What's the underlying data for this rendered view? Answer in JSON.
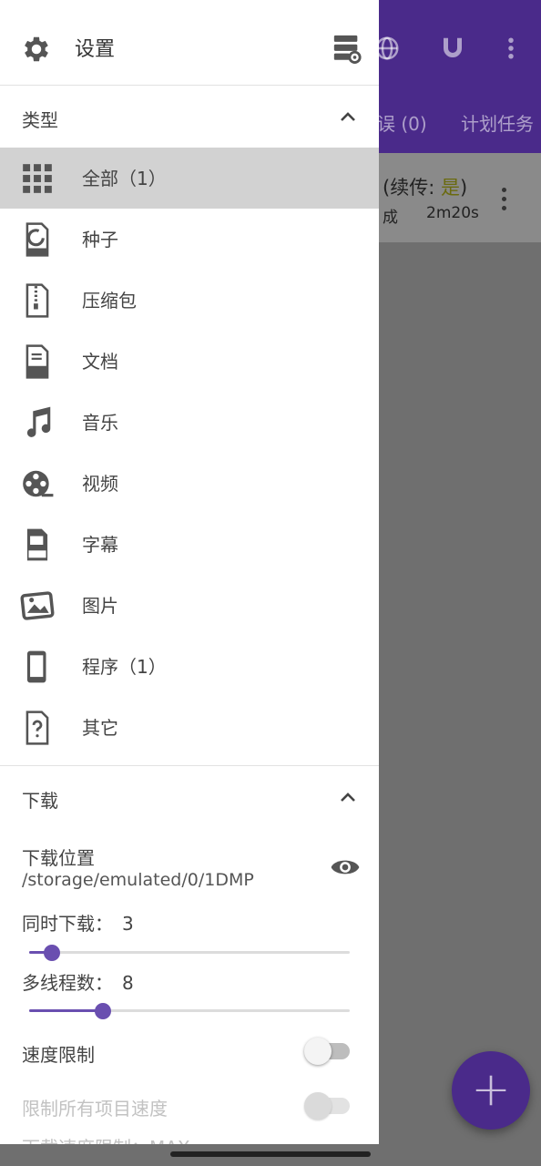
{
  "background_app": {
    "tabs": [
      "误 (0)",
      "计划任务"
    ],
    "task": {
      "title_prefix": "(续传: ",
      "resume_value": "是",
      "title_suffix": ")",
      "status": "成",
      "elapsed": "2m20s"
    },
    "toolbar_icons": [
      "globe-icon",
      "magnet-icon",
      "more-vert-icon"
    ],
    "fab_icon": "plus-icon"
  },
  "drawer": {
    "header": {
      "title": "设置",
      "icon": "gear-icon",
      "action_icon": "server-settings-icon"
    },
    "types_section": {
      "title": "类型",
      "items": [
        {
          "label": "全部（1）",
          "icon": "grid-icon",
          "active": true
        },
        {
          "label": "种子",
          "icon": "torrent-file-icon"
        },
        {
          "label": "压缩包",
          "icon": "zip-file-icon"
        },
        {
          "label": "文档",
          "icon": "doc-file-icon"
        },
        {
          "label": "音乐",
          "icon": "music-note-icon"
        },
        {
          "label": "视频",
          "icon": "film-reel-icon"
        },
        {
          "label": "字幕",
          "icon": "srt-file-icon"
        },
        {
          "label": "图片",
          "icon": "image-icon"
        },
        {
          "label": "程序（1）",
          "icon": "phone-icon"
        },
        {
          "label": "其它",
          "icon": "unknown-file-icon"
        }
      ]
    },
    "download_section": {
      "title": "下载",
      "location_label": "下载位置",
      "location_path": "/storage/emulated/0/1DMP",
      "concurrent_label": "同时下载：",
      "concurrent_value": "3",
      "concurrent_fraction": 0.07,
      "threads_label": "多线程数：",
      "threads_value": "8",
      "threads_fraction": 0.23,
      "speed_limit_label": "速度限制",
      "speed_limit_on": false,
      "limit_all_label": "限制所有项目速度",
      "limit_all_on": false,
      "speed_limit_value_label": "下载速度限制：MAX"
    }
  },
  "colors": {
    "accent": "#6a4fb0",
    "app_bar": "#4a2a8a",
    "active_row": "#d2d2d2"
  }
}
